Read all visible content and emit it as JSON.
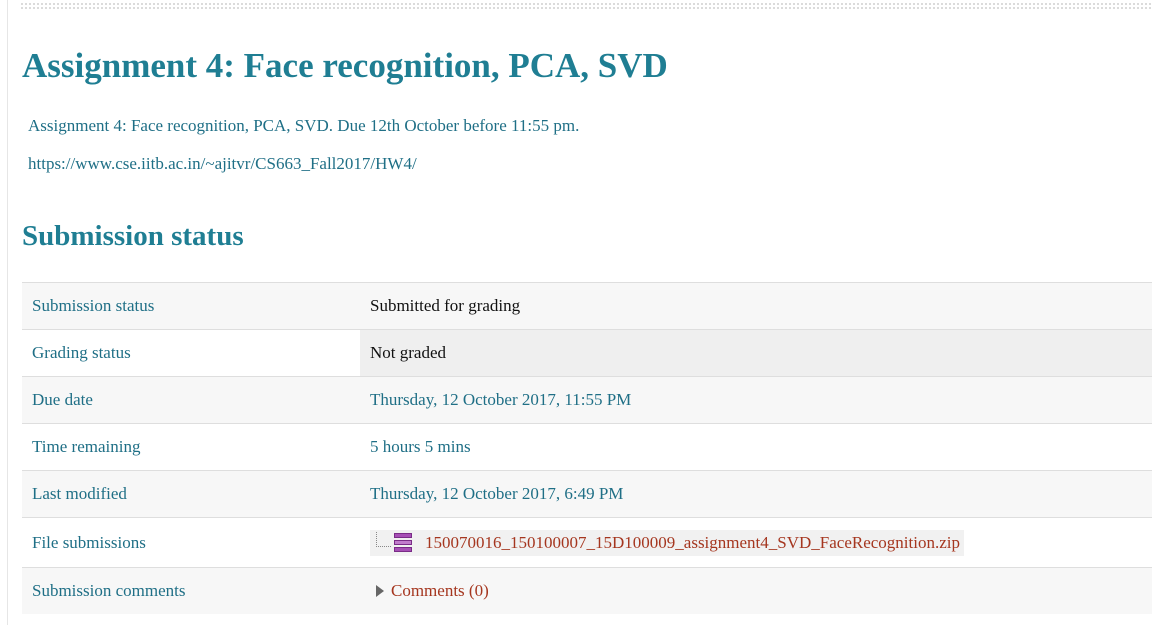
{
  "assignment": {
    "title": "Assignment 4: Face recognition, PCA, SVD",
    "description": "Assignment 4: Face recognition, PCA, SVD. Due 12th October before 11:55 pm.",
    "link": "https://www.cse.iitb.ac.in/~ajitvr/CS663_Fall2017/HW4/"
  },
  "section_title": "Submission status",
  "status_rows": [
    {
      "label": "Submission status",
      "value": "Submitted for grading"
    },
    {
      "label": "Grading status",
      "value": "Not graded"
    },
    {
      "label": "Due date",
      "value": "Thursday, 12 October 2017, 11:55 PM"
    },
    {
      "label": "Time remaining",
      "value": "5 hours 5 mins"
    },
    {
      "label": "Last modified",
      "value": "Thursday, 12 October 2017, 6:49 PM"
    },
    {
      "label": "File submissions",
      "value": "150070016_150100007_15D100009_assignment4_SVD_FaceRecognition.zip",
      "icon": "zip-archive-icon"
    },
    {
      "label": "Submission comments",
      "value": "Comments (0)",
      "icon": "triangle-right-icon"
    }
  ],
  "colors": {
    "heading": "#1f7e93",
    "label_text": "#1f6f86",
    "link_file": "#a5361f",
    "row_alt_bg": "#f7f7f7",
    "grading_value_bg": "#efefef"
  }
}
